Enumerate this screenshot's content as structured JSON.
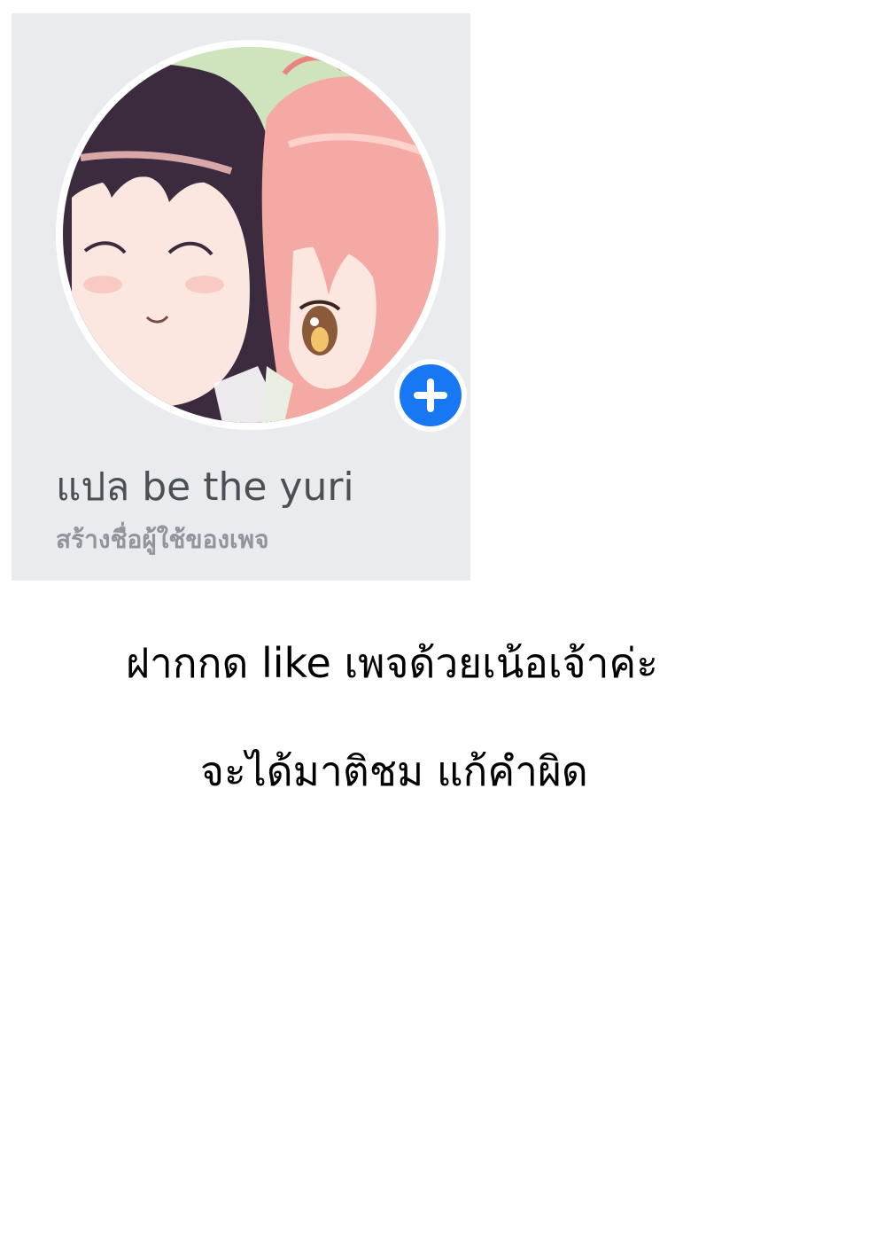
{
  "profile": {
    "page_name": "แปล be the yuri",
    "create_username_link": "สร้างชื่อผู้ใช้ของเพจ",
    "avatar_description": "anime-style illustration of two girls, one with dark hair and one with pink hair",
    "add_icon": "plus-icon",
    "colors": {
      "card_background": "#e9ebee",
      "add_button": "#1877f2",
      "page_name_text": "#4b4f56",
      "link_text": "#90949c"
    }
  },
  "message": {
    "line1": "ฝากกด like เพจด้วยเน้อเจ้าค่ะ",
    "line2": "จะได้มาติชม แก้คำผิด"
  }
}
